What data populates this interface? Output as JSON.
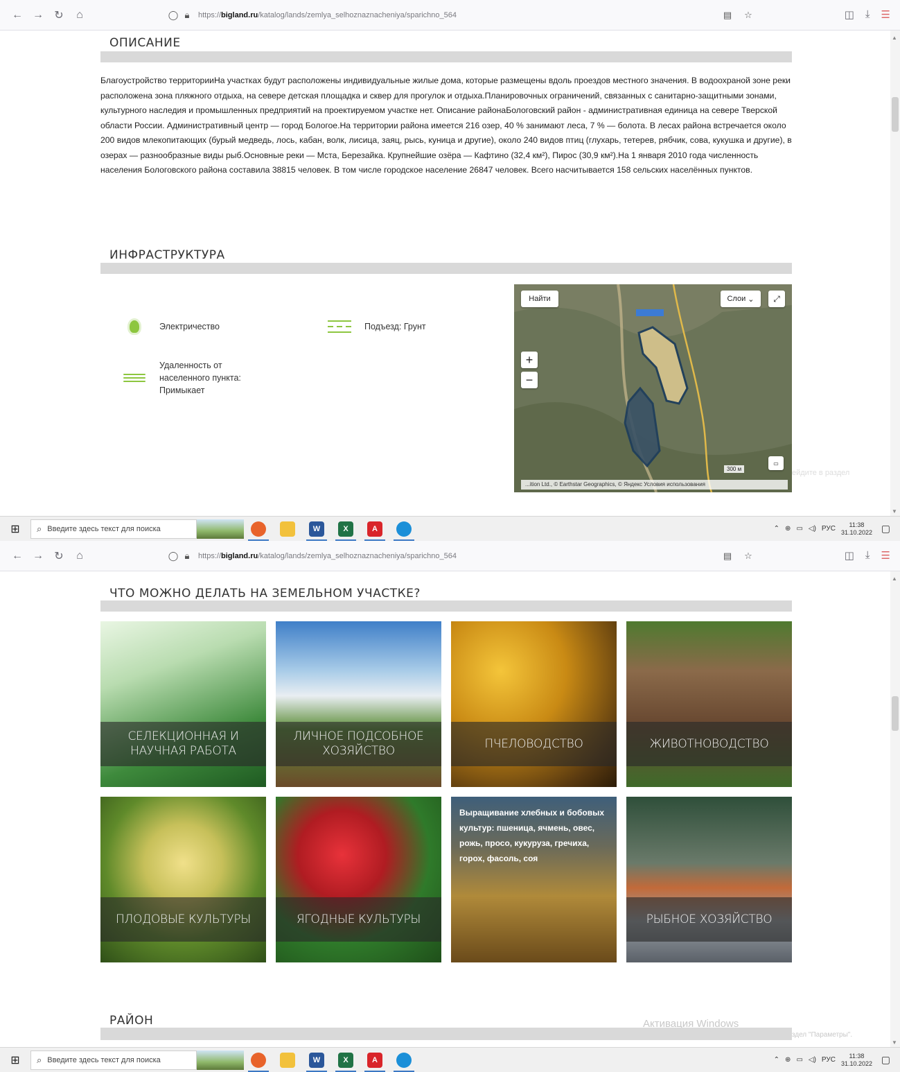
{
  "browser": {
    "url_prefix": "https://",
    "url_host": "bigland.ru",
    "url_path": "/katalog/lands/zemlya_selhoznaznacheniya/sparichno_564"
  },
  "description": {
    "title": "ОПИСАНИЕ",
    "text": "Благоустройство территорииНа участках будут расположены индивидуальные жилые дома, которые размещены вдоль проездов местного значения. В водоохраной зоне реки расположена зона пляжного отдыха, на севере детская площадка и сквер для прогулок и отдыха.Планировочных ограничений, связанных с санитарно-защитными зонами, культурного наследия и промышленных предприятий на проектируемом участке нет. Описание районаБологовский район - административная единица на севере Тверской области России. Административный центр — город Бологое.На территории района имеется 216 озер, 40 % занимают леса, 7 % — болота. В лесах района встречается около 200 видов млекопитающих (бурый медведь, лось, кабан, волк, лисица, заяц, рысь, куница и другие), около 240 видов птиц (глухарь, тетерев, рябчик, сова, кукушка и другие), в озерах — разнообразные виды рыб.Основные реки — Мста, Березайка. Крупнейшие озёра — Кафтино (32,4 км²), Пирос (30,9 км²).На 1 января 2010 года численность населения Бологовского района составила 38815 человек. В том числе городское население 26847 человек. Всего насчитывается 158 сельских населённых пунктов."
  },
  "infrastructure": {
    "title": "ИНФРАСТРУКТУРА",
    "items": [
      {
        "icon": "lightbulb-icon",
        "label": "Электричество"
      },
      {
        "icon": "road-icon",
        "label": "Подъезд: Грунт"
      },
      {
        "icon": "water-waves-icon",
        "label": "Удаленность от населенного пункта: Примыкает"
      }
    ]
  },
  "map": {
    "find_label": "Найти",
    "layers_label": "Слои",
    "zoom_in": "+",
    "zoom_out": "−",
    "scale": "300 м",
    "copyright": "...ition Ltd., © Earthstar Geographics, © Яндекс Условия использования"
  },
  "activities": {
    "title": "ЧТО МОЖНО ДЕЛАТЬ НА ЗЕМЕЛЬНОМ УЧАСТКЕ?",
    "tiles": [
      {
        "caption": "СЕЛЕКЦИОННАЯ И НАУЧНАЯ РАБОТА"
      },
      {
        "caption": "ЛИЧНОЕ ПОДСОБНОЕ ХОЗЯЙСТВО"
      },
      {
        "caption": "ПЧЕЛОВОДСТВО"
      },
      {
        "caption": "ЖИВОТНОВОДСТВО"
      },
      {
        "caption": "ПЛОДОВЫЕ КУЛЬТУРЫ"
      },
      {
        "caption": "ЯГОДНЫЕ КУЛЬТУРЫ"
      },
      {
        "caption": "",
        "overlay_text": "Выращивание хлебных и бобовых культур: пшеница, ячмень, овес, рожь, просо, кукуруза, гречиха, горох, фасоль, соя"
      },
      {
        "caption": "РЫБНОЕ ХОЗЯЙСТВО"
      }
    ]
  },
  "district": {
    "title": "РАЙОН"
  },
  "watermark": {
    "title": "Активация Windows",
    "text": "Чтобы активировать Windows, перейдите в раздел \"Параметры\".",
    "partial": "ейдите в раздел"
  },
  "taskbar": {
    "search_placeholder": "Введите здесь текст для поиска",
    "lang": "РУС",
    "time": "11:38",
    "date": "31.10.2022"
  },
  "colors": {
    "accent": "#8dc63f",
    "section_bar": "#d9d9d9"
  }
}
